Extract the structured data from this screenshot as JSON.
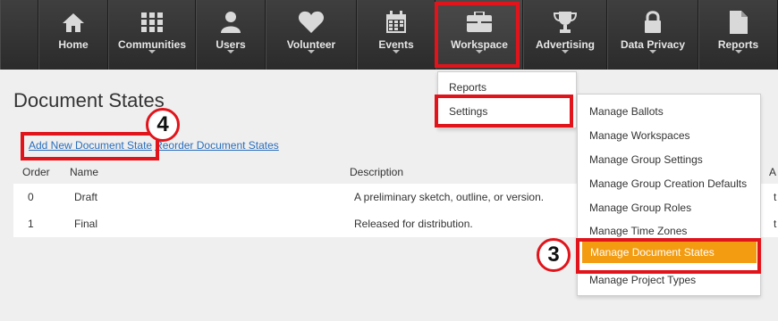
{
  "nav": {
    "items": [
      {
        "label": "Home",
        "icon": "home-icon"
      },
      {
        "label": "Communities",
        "icon": "grid-icon"
      },
      {
        "label": "Users",
        "icon": "user-icon"
      },
      {
        "label": "Volunteer",
        "icon": "heart-icon"
      },
      {
        "label": "Events",
        "icon": "calendar-icon"
      },
      {
        "label": "Workspace",
        "icon": "briefcase-icon"
      },
      {
        "label": "Advertising",
        "icon": "trophy-icon"
      },
      {
        "label": "Data Privacy",
        "icon": "lock-icon"
      },
      {
        "label": "Reports",
        "icon": "document-icon"
      }
    ]
  },
  "page": {
    "title": "Document States",
    "add_link": "Add New Document State",
    "reorder_link": "Reorder Document States"
  },
  "table": {
    "headers": {
      "order": "Order",
      "name": "Name",
      "description": "Description",
      "extra": "A"
    },
    "rows": [
      {
        "order": "0",
        "name": "Draft",
        "description": "A preliminary sketch, outline, or version.",
        "extra": "t"
      },
      {
        "order": "1",
        "name": "Final",
        "description": "Released for distribution.",
        "extra": "t"
      }
    ]
  },
  "workspace_menu": {
    "items": [
      "Reports",
      "Settings"
    ]
  },
  "settings_menu": {
    "items": [
      "Manage Ballots",
      "Manage Workspaces",
      "Manage Group Settings",
      "Manage Group Creation Defaults",
      "Manage Group Roles",
      "Manage Time Zones",
      "Manage Document States",
      "Manage Project Types"
    ],
    "selected": "Manage Document States"
  },
  "annotations": {
    "step3": "3",
    "step4": "4"
  },
  "colors": {
    "highlight": "#e1141b",
    "selected": "#f39c12",
    "link": "#2a6ebb"
  }
}
